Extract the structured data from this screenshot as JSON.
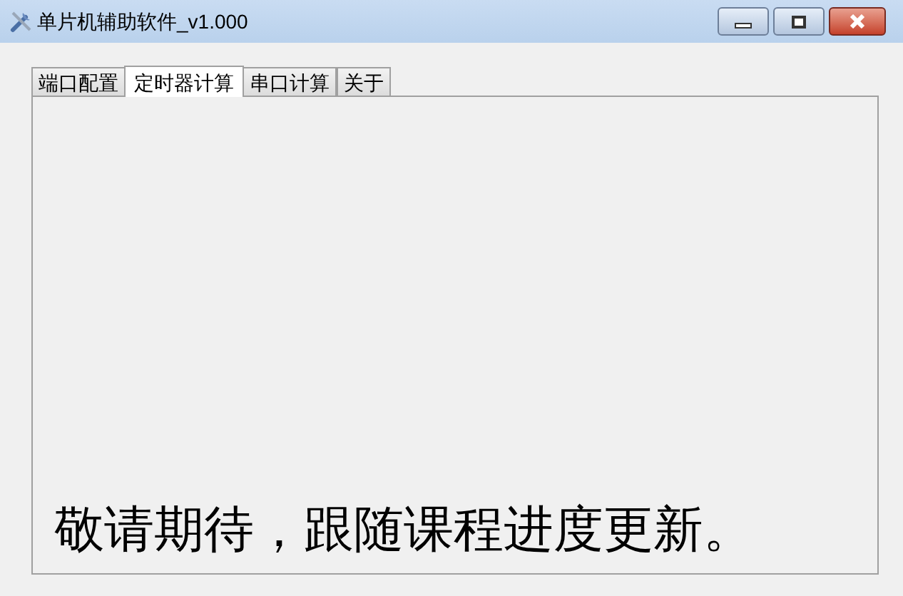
{
  "window": {
    "title": "单片机辅助软件_v1.000"
  },
  "tabs": [
    {
      "label": "端口配置",
      "selected": false
    },
    {
      "label": "定时器计算",
      "selected": true
    },
    {
      "label": "串口计算",
      "selected": false
    },
    {
      "label": "关于",
      "selected": false
    }
  ],
  "panel": {
    "message": "敬请期待，跟随课程进度更新。"
  }
}
